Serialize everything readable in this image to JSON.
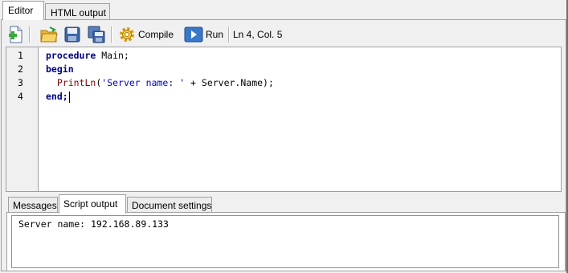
{
  "tabs": [
    {
      "label": "Editor",
      "active": true
    },
    {
      "label": "HTML output",
      "active": false
    }
  ],
  "toolbar": {
    "new_icon": "new-file-icon",
    "open_icon": "open-folder-icon",
    "save_icon": "save-icon",
    "saveall_icon": "save-all-icon",
    "compile_icon": "gear-icon",
    "compile_label": "Compile",
    "run_icon": "play-icon",
    "run_label": "Run",
    "position": "Ln 4, Col. 5"
  },
  "editor": {
    "line_numbers": [
      "1",
      "2",
      "3",
      "4"
    ],
    "lines": [
      [
        {
          "t": "procedure",
          "c": "kw"
        },
        {
          "t": " Main;",
          "c": "id"
        }
      ],
      [
        {
          "t": "begin",
          "c": "kw"
        }
      ],
      [
        {
          "t": "  ",
          "c": "id"
        },
        {
          "t": "PrintLn",
          "c": "fn"
        },
        {
          "t": "(",
          "c": "id"
        },
        {
          "t": "'Server name: '",
          "c": "str"
        },
        {
          "t": " + Server.Name);",
          "c": "id"
        }
      ],
      [
        {
          "t": "end;",
          "c": "kw"
        }
      ]
    ]
  },
  "bottom_tabs": [
    {
      "label": "Messages",
      "active": false
    },
    {
      "label": "Script output",
      "active": true
    },
    {
      "label": "Document settings",
      "active": false
    }
  ],
  "output": {
    "text": "Server name: 192.168.89.133"
  },
  "colors": {
    "keyword": "#000080",
    "function": "#800000",
    "string": "#0000c0"
  }
}
